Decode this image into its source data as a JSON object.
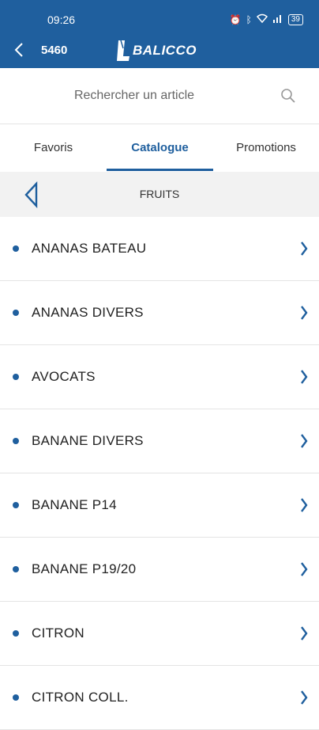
{
  "status": {
    "time": "09:26",
    "battery": "39"
  },
  "app": {
    "account": "5460",
    "logo_text": "BALICCO"
  },
  "search": {
    "placeholder": "Rechercher un article"
  },
  "tabs": [
    {
      "label": "Favoris",
      "active": false
    },
    {
      "label": "Catalogue",
      "active": true
    },
    {
      "label": "Promotions",
      "active": false
    }
  ],
  "category": {
    "title": "FRUITS"
  },
  "items": [
    {
      "label": "ANANAS BATEAU"
    },
    {
      "label": "ANANAS DIVERS"
    },
    {
      "label": "AVOCATS"
    },
    {
      "label": "BANANE DIVERS"
    },
    {
      "label": "BANANE P14"
    },
    {
      "label": "BANANE P19/20"
    },
    {
      "label": "CITRON"
    },
    {
      "label": "CITRON COLL."
    }
  ],
  "colors": {
    "primary": "#1f5f9e",
    "header_bg": "#f2f2f2"
  },
  "icons": [
    "back-arrow-icon",
    "search-icon",
    "category-back-icon",
    "chevron-right-icon",
    "wifi-icon",
    "bluetooth-icon",
    "signal-icon",
    "battery-icon",
    "alarm-icon"
  ]
}
